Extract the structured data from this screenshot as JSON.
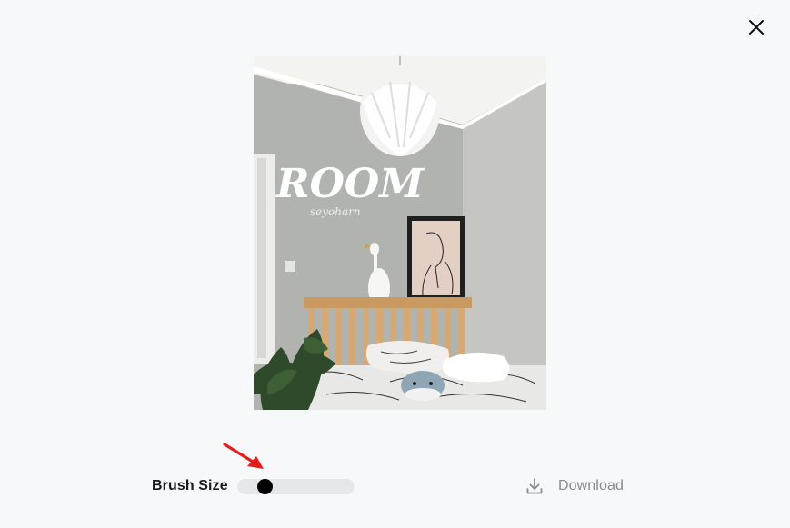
{
  "modal": {
    "close_icon": "close-icon"
  },
  "image": {
    "title_text": "ROOM",
    "subtitle_text": "seyoharn"
  },
  "controls": {
    "brush_size_label": "Brush Size",
    "brush_size_value_fraction": 0.1,
    "download_label": "Download",
    "download_icon": "download-icon",
    "arrow_color": "#e31b1b"
  }
}
